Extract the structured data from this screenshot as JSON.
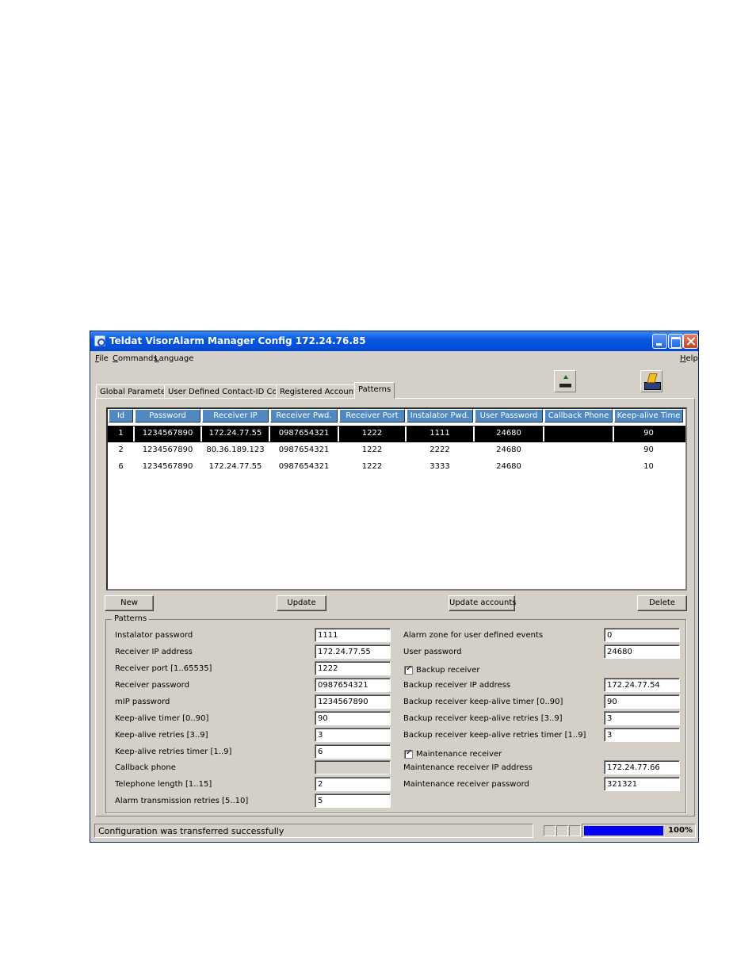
{
  "window": {
    "title": "Teldat VisorAlarm Manager Config 172.24.76.85"
  },
  "menu": {
    "file": "File",
    "commands": "Commands",
    "language": "Language",
    "help": "Help"
  },
  "toolbar": {
    "upload_icon": "upload-icon",
    "modem_icon": "modem-icon"
  },
  "tabs": [
    {
      "label": "Global Parameters"
    },
    {
      "label": "User Defined Contact-ID Codes"
    },
    {
      "label": "Registered Accounts"
    },
    {
      "label": "Patterns",
      "active": true
    }
  ],
  "grid": {
    "columns": [
      "Id",
      "Password",
      "Receiver IP",
      "Receiver Pwd.",
      "Receiver Port",
      "Instalator Pwd.",
      "User Password",
      "Callback Phone",
      "Keep-alive Time"
    ],
    "rows": [
      [
        "1",
        "1234567890",
        "172.24.77.55",
        "0987654321",
        "1222",
        "1111",
        "24680",
        "",
        "90"
      ],
      [
        "2",
        "1234567890",
        "80.36.189.123",
        "0987654321",
        "1222",
        "2222",
        "24680",
        "",
        "90"
      ],
      [
        "6",
        "1234567890",
        "172.24.77.55",
        "0987654321",
        "1222",
        "3333",
        "24680",
        "",
        "10"
      ]
    ],
    "selected_row": 0
  },
  "buttons": {
    "new": "New",
    "update": "Update",
    "update_accounts": "Update accounts",
    "delete": "Delete"
  },
  "patterns": {
    "title": "Patterns",
    "left": [
      {
        "label": "Instalator password",
        "value": "1111"
      },
      {
        "label": "Receiver IP address",
        "value": "172.24.77.55"
      },
      {
        "label": "Receiver port [1..65535]",
        "value": "1222"
      },
      {
        "label": "Receiver password",
        "value": "0987654321"
      },
      {
        "label": "mIP password",
        "value": "1234567890"
      },
      {
        "label": "Keep-alive timer [0..90]",
        "value": "90"
      },
      {
        "label": "Keep-alive retries [3..9]",
        "value": "3"
      },
      {
        "label": "Keep-alive retries timer [1..9]",
        "value": "6"
      },
      {
        "label": "Callback phone",
        "value": ""
      },
      {
        "label": "Telephone length [1..15]",
        "value": "2"
      },
      {
        "label": "Alarm transmission retries [5..10]",
        "value": "5"
      }
    ],
    "right": {
      "alarm_zone_label": "Alarm zone for user defined events",
      "alarm_zone_value": "0",
      "user_password_label": "User password",
      "user_password_value": "24680",
      "backup_receiver_label": "Backup receiver",
      "backup_receiver_checked": true,
      "backup_ip_label": "Backup receiver IP address",
      "backup_ip_value": "172.24.77.54",
      "backup_ka_timer_label": "Backup receiver keep-alive timer [0..90]",
      "backup_ka_timer_value": "90",
      "backup_ka_retries_label": "Backup receiver keep-alive retries [3..9]",
      "backup_ka_retries_value": "3",
      "backup_ka_retries_timer_label": "Backup receiver keep-alive retries timer [1..9]",
      "backup_ka_retries_timer_value": "3",
      "maintenance_label": "Maintenance receiver",
      "maintenance_checked": true,
      "maintenance_ip_label": "Maintenance receiver IP address",
      "maintenance_ip_value": "172.24.77.66",
      "maintenance_pwd_label": "Maintenance receiver password",
      "maintenance_pwd_value": "321321"
    }
  },
  "status": {
    "message": "Configuration was transferred successfully",
    "progress_text": "100%",
    "progress": 1.0
  },
  "colors": {
    "title_bar": "#0349d4",
    "grid_header": "#5088c0",
    "selected_row": "#000000",
    "progress": "#0000ee"
  }
}
